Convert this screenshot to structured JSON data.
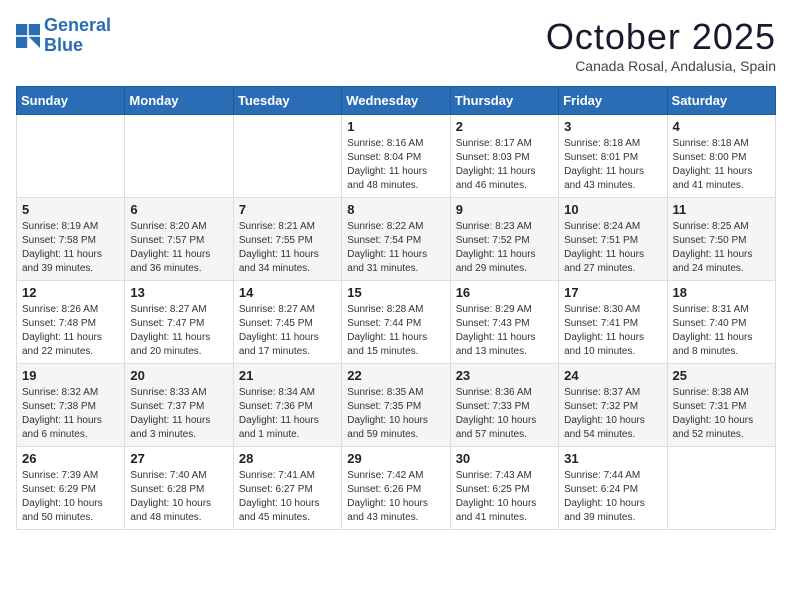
{
  "logo": {
    "line1": "General",
    "line2": "Blue"
  },
  "title": "October 2025",
  "subtitle": "Canada Rosal, Andalusia, Spain",
  "days_of_week": [
    "Sunday",
    "Monday",
    "Tuesday",
    "Wednesday",
    "Thursday",
    "Friday",
    "Saturday"
  ],
  "weeks": [
    [
      {
        "day": "",
        "info": ""
      },
      {
        "day": "",
        "info": ""
      },
      {
        "day": "",
        "info": ""
      },
      {
        "day": "1",
        "info": "Sunrise: 8:16 AM\nSunset: 8:04 PM\nDaylight: 11 hours and 48 minutes."
      },
      {
        "day": "2",
        "info": "Sunrise: 8:17 AM\nSunset: 8:03 PM\nDaylight: 11 hours and 46 minutes."
      },
      {
        "day": "3",
        "info": "Sunrise: 8:18 AM\nSunset: 8:01 PM\nDaylight: 11 hours and 43 minutes."
      },
      {
        "day": "4",
        "info": "Sunrise: 8:18 AM\nSunset: 8:00 PM\nDaylight: 11 hours and 41 minutes."
      }
    ],
    [
      {
        "day": "5",
        "info": "Sunrise: 8:19 AM\nSunset: 7:58 PM\nDaylight: 11 hours and 39 minutes."
      },
      {
        "day": "6",
        "info": "Sunrise: 8:20 AM\nSunset: 7:57 PM\nDaylight: 11 hours and 36 minutes."
      },
      {
        "day": "7",
        "info": "Sunrise: 8:21 AM\nSunset: 7:55 PM\nDaylight: 11 hours and 34 minutes."
      },
      {
        "day": "8",
        "info": "Sunrise: 8:22 AM\nSunset: 7:54 PM\nDaylight: 11 hours and 31 minutes."
      },
      {
        "day": "9",
        "info": "Sunrise: 8:23 AM\nSunset: 7:52 PM\nDaylight: 11 hours and 29 minutes."
      },
      {
        "day": "10",
        "info": "Sunrise: 8:24 AM\nSunset: 7:51 PM\nDaylight: 11 hours and 27 minutes."
      },
      {
        "day": "11",
        "info": "Sunrise: 8:25 AM\nSunset: 7:50 PM\nDaylight: 11 hours and 24 minutes."
      }
    ],
    [
      {
        "day": "12",
        "info": "Sunrise: 8:26 AM\nSunset: 7:48 PM\nDaylight: 11 hours and 22 minutes."
      },
      {
        "day": "13",
        "info": "Sunrise: 8:27 AM\nSunset: 7:47 PM\nDaylight: 11 hours and 20 minutes."
      },
      {
        "day": "14",
        "info": "Sunrise: 8:27 AM\nSunset: 7:45 PM\nDaylight: 11 hours and 17 minutes."
      },
      {
        "day": "15",
        "info": "Sunrise: 8:28 AM\nSunset: 7:44 PM\nDaylight: 11 hours and 15 minutes."
      },
      {
        "day": "16",
        "info": "Sunrise: 8:29 AM\nSunset: 7:43 PM\nDaylight: 11 hours and 13 minutes."
      },
      {
        "day": "17",
        "info": "Sunrise: 8:30 AM\nSunset: 7:41 PM\nDaylight: 11 hours and 10 minutes."
      },
      {
        "day": "18",
        "info": "Sunrise: 8:31 AM\nSunset: 7:40 PM\nDaylight: 11 hours and 8 minutes."
      }
    ],
    [
      {
        "day": "19",
        "info": "Sunrise: 8:32 AM\nSunset: 7:38 PM\nDaylight: 11 hours and 6 minutes."
      },
      {
        "day": "20",
        "info": "Sunrise: 8:33 AM\nSunset: 7:37 PM\nDaylight: 11 hours and 3 minutes."
      },
      {
        "day": "21",
        "info": "Sunrise: 8:34 AM\nSunset: 7:36 PM\nDaylight: 11 hours and 1 minute."
      },
      {
        "day": "22",
        "info": "Sunrise: 8:35 AM\nSunset: 7:35 PM\nDaylight: 10 hours and 59 minutes."
      },
      {
        "day": "23",
        "info": "Sunrise: 8:36 AM\nSunset: 7:33 PM\nDaylight: 10 hours and 57 minutes."
      },
      {
        "day": "24",
        "info": "Sunrise: 8:37 AM\nSunset: 7:32 PM\nDaylight: 10 hours and 54 minutes."
      },
      {
        "day": "25",
        "info": "Sunrise: 8:38 AM\nSunset: 7:31 PM\nDaylight: 10 hours and 52 minutes."
      }
    ],
    [
      {
        "day": "26",
        "info": "Sunrise: 7:39 AM\nSunset: 6:29 PM\nDaylight: 10 hours and 50 minutes."
      },
      {
        "day": "27",
        "info": "Sunrise: 7:40 AM\nSunset: 6:28 PM\nDaylight: 10 hours and 48 minutes."
      },
      {
        "day": "28",
        "info": "Sunrise: 7:41 AM\nSunset: 6:27 PM\nDaylight: 10 hours and 45 minutes."
      },
      {
        "day": "29",
        "info": "Sunrise: 7:42 AM\nSunset: 6:26 PM\nDaylight: 10 hours and 43 minutes."
      },
      {
        "day": "30",
        "info": "Sunrise: 7:43 AM\nSunset: 6:25 PM\nDaylight: 10 hours and 41 minutes."
      },
      {
        "day": "31",
        "info": "Sunrise: 7:44 AM\nSunset: 6:24 PM\nDaylight: 10 hours and 39 minutes."
      },
      {
        "day": "",
        "info": ""
      }
    ]
  ]
}
